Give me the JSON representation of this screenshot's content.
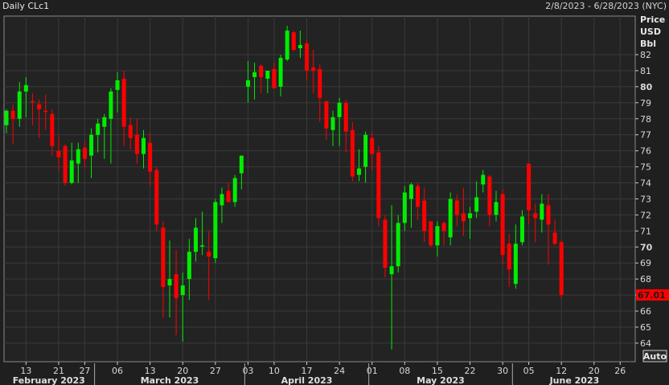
{
  "header": {
    "title": "Daily CLc1",
    "date_range": "2/8/2023 - 6/28/2023 (NYC)"
  },
  "axis_units": [
    "Price",
    "USD",
    "Bbl"
  ],
  "auto_button": "Auto",
  "colors": {
    "up": "#00ee00",
    "down": "#ff0000",
    "background": "#232323",
    "grid": "#3a3a3a",
    "last_price_bg": "#ff0000"
  },
  "chart_data": {
    "type": "candlestick",
    "title": "Daily CLc1",
    "ylabel": "Price USD Bbl",
    "ylim": [
      63.4,
      84.5
    ],
    "yticks": [
      64,
      65,
      66,
      67,
      68,
      69,
      70,
      71,
      72,
      73,
      74,
      75,
      76,
      77,
      78,
      79,
      80,
      81,
      82
    ],
    "bold_yticks": [
      70,
      80
    ],
    "last_price": "67.01",
    "grid": true,
    "columns": [
      "date",
      "open",
      "high",
      "low",
      "close"
    ],
    "candles": [
      [
        "02-08",
        77.6,
        78.6,
        77.1,
        78.5
      ],
      [
        "02-09",
        78.5,
        78.9,
        76.4,
        78.0
      ],
      [
        "02-10",
        78.0,
        80.3,
        77.5,
        79.7
      ],
      [
        "02-13",
        79.7,
        80.6,
        78.1,
        80.1
      ],
      [
        "02-14",
        79.1,
        79.6,
        77.6,
        79.05
      ],
      [
        "02-15",
        78.9,
        79.2,
        76.8,
        78.6
      ],
      [
        "02-16",
        78.5,
        79.5,
        77.3,
        78.45
      ],
      [
        "02-17",
        78.3,
        78.6,
        75.7,
        76.3
      ],
      [
        "02-21",
        76.0,
        76.9,
        74.8,
        75.6
      ],
      [
        "02-22",
        76.3,
        76.4,
        73.8,
        74.0
      ],
      [
        "02-23",
        74.0,
        76.5,
        73.9,
        75.4
      ],
      [
        "02-24",
        75.2,
        76.5,
        74.0,
        76.1
      ],
      [
        "02-27",
        76.2,
        76.6,
        75.0,
        75.5
      ],
      [
        "02-28",
        75.7,
        77.4,
        74.3,
        77.0
      ],
      [
        "03-01",
        77.0,
        78.0,
        75.9,
        77.7
      ],
      [
        "03-02",
        77.5,
        78.3,
        75.5,
        78.1
      ],
      [
        "03-03",
        78.0,
        79.9,
        75.2,
        79.7
      ],
      [
        "03-06",
        79.8,
        80.9,
        78.4,
        80.4
      ],
      [
        "03-07",
        80.5,
        81.0,
        76.3,
        77.5
      ],
      [
        "03-08",
        77.6,
        78.1,
        76.1,
        76.8
      ],
      [
        "03-09",
        77.0,
        78.0,
        75.2,
        75.8
      ],
      [
        "03-10",
        75.8,
        77.3,
        74.9,
        76.8
      ],
      [
        "03-13",
        76.5,
        77.1,
        73.8,
        74.7
      ],
      [
        "03-14",
        74.8,
        75.0,
        71.0,
        71.4
      ],
      [
        "03-15",
        71.2,
        71.6,
        65.6,
        67.5
      ],
      [
        "03-16",
        67.6,
        70.4,
        65.6,
        68.0
      ],
      [
        "03-17",
        68.3,
        69.8,
        64.5,
        66.8
      ],
      [
        "03-20",
        67.0,
        68.4,
        64.1,
        67.6
      ],
      [
        "03-21",
        68.0,
        70.5,
        66.7,
        69.7
      ],
      [
        "03-22",
        69.7,
        71.8,
        69.1,
        71.2
      ],
      [
        "03-23",
        70.05,
        72.2,
        69.5,
        70.1
      ],
      [
        "03-24",
        69.7,
        71.0,
        66.7,
        69.4
      ],
      [
        "03-27",
        69.3,
        73.0,
        69.0,
        72.8
      ],
      [
        "03-28",
        72.6,
        73.7,
        71.5,
        73.3
      ],
      [
        "03-29",
        73.5,
        74.0,
        72.8,
        72.8
      ],
      [
        "03-30",
        72.8,
        74.5,
        72.5,
        74.3
      ],
      [
        "03-31",
        74.6,
        75.7,
        73.6,
        75.7
      ],
      [
        "04-03",
        80.0,
        81.6,
        79.0,
        80.4
      ],
      [
        "04-04",
        80.6,
        81.5,
        79.2,
        80.9
      ],
      [
        "04-05",
        81.3,
        81.4,
        79.6,
        80.6
      ],
      [
        "04-06",
        80.5,
        81.0,
        79.6,
        81.0
      ],
      [
        "04-10",
        81.1,
        81.5,
        79.9,
        79.9
      ],
      [
        "04-11",
        80.0,
        82.0,
        79.4,
        81.8
      ],
      [
        "04-12",
        81.7,
        83.8,
        81.6,
        83.5
      ],
      [
        "04-13",
        83.4,
        83.5,
        82.2,
        82.3
      ],
      [
        "04-14",
        82.4,
        83.5,
        81.8,
        82.6
      ],
      [
        "04-17",
        82.7,
        82.9,
        80.4,
        81.0
      ],
      [
        "04-18",
        81.2,
        82.3,
        79.6,
        81.0
      ],
      [
        "04-19",
        81.1,
        81.4,
        77.8,
        79.3
      ],
      [
        "04-20",
        79.1,
        79.1,
        76.7,
        77.4
      ],
      [
        "04-21",
        77.3,
        78.5,
        76.3,
        78.1
      ],
      [
        "04-24",
        78.1,
        79.3,
        76.3,
        79.0
      ],
      [
        "04-25",
        79.0,
        79.2,
        75.9,
        77.2
      ],
      [
        "04-26",
        77.3,
        77.8,
        74.1,
        74.4
      ],
      [
        "04-27",
        74.5,
        76.1,
        74.1,
        74.9
      ],
      [
        "04-28",
        75.0,
        77.2,
        74.0,
        77.0
      ],
      [
        "05-01",
        76.8,
        77.2,
        74.8,
        75.8
      ],
      [
        "05-02",
        75.9,
        76.3,
        71.3,
        71.8
      ],
      [
        "05-03",
        71.7,
        72.0,
        68.1,
        68.7
      ],
      [
        "05-04",
        68.3,
        72.6,
        63.6,
        68.8
      ],
      [
        "05-05",
        68.8,
        72.0,
        68.4,
        71.5
      ],
      [
        "05-08",
        71.5,
        73.8,
        71.0,
        73.4
      ],
      [
        "05-09",
        73.0,
        74.0,
        71.2,
        73.9
      ],
      [
        "05-10",
        73.8,
        74.0,
        71.7,
        72.5
      ],
      [
        "05-11",
        72.9,
        73.7,
        70.3,
        71.0
      ],
      [
        "05-12",
        71.6,
        71.6,
        70.0,
        70.1
      ],
      [
        "05-15",
        70.1,
        71.6,
        69.4,
        71.3
      ],
      [
        "05-16",
        71.5,
        71.6,
        70.1,
        71.0
      ],
      [
        "05-17",
        70.6,
        73.4,
        70.1,
        73.0
      ],
      [
        "05-18",
        72.9,
        73.3,
        71.3,
        72.0
      ],
      [
        "05-19",
        72.1,
        73.7,
        70.7,
        71.6
      ],
      [
        "05-22",
        71.8,
        72.5,
        70.5,
        72.1
      ],
      [
        "05-23",
        72.2,
        74.1,
        71.8,
        73.1
      ],
      [
        "05-24",
        73.9,
        74.8,
        73.4,
        74.5
      ],
      [
        "05-25",
        74.4,
        74.5,
        71.3,
        72.0
      ],
      [
        "05-26",
        72.0,
        73.5,
        71.6,
        72.8
      ],
      [
        "05-30",
        73.3,
        73.6,
        68.9,
        69.5
      ],
      [
        "05-31",
        70.2,
        70.8,
        67.5,
        68.6
      ],
      [
        "06-01",
        67.7,
        71.4,
        67.4,
        70.2
      ],
      [
        "06-02",
        70.3,
        72.3,
        70.1,
        71.9
      ],
      [
        "06-05",
        75.2,
        75.2,
        71.4,
        72.3
      ],
      [
        "06-06",
        72.1,
        72.7,
        70.3,
        71.8
      ],
      [
        "06-07",
        71.7,
        73.3,
        70.9,
        72.7
      ],
      [
        "06-08",
        72.6,
        73.3,
        68.9,
        71.4
      ],
      [
        "06-09",
        70.9,
        71.7,
        70.1,
        70.2
      ],
      [
        "06-12",
        70.3,
        70.4,
        66.8,
        67.01
      ]
    ],
    "axis_extension_dates": [
      "06-13",
      "06-14",
      "06-15",
      "06-16",
      "06-20",
      "06-21",
      "06-22",
      "06-23",
      "06-26",
      "06-27",
      "06-28"
    ],
    "xticks": [
      {
        "date": "02-13",
        "label": "13"
      },
      {
        "date": "02-21",
        "label": "21"
      },
      {
        "date": "02-27",
        "label": "27"
      },
      {
        "date": "03-06",
        "label": "06"
      },
      {
        "date": "03-13",
        "label": "13"
      },
      {
        "date": "03-20",
        "label": "20"
      },
      {
        "date": "03-27",
        "label": "27"
      },
      {
        "date": "04-03",
        "label": "03"
      },
      {
        "date": "04-10",
        "label": "10"
      },
      {
        "date": "04-17",
        "label": "17"
      },
      {
        "date": "04-24",
        "label": "24"
      },
      {
        "date": "05-01",
        "label": "01"
      },
      {
        "date": "05-08",
        "label": "08"
      },
      {
        "date": "05-15",
        "label": "15"
      },
      {
        "date": "05-22",
        "label": "22"
      },
      {
        "date": "05-30",
        "label": "30"
      },
      {
        "date": "06-05",
        "label": "05"
      },
      {
        "date": "06-12",
        "label": "12"
      },
      {
        "date": "06-20",
        "label": "20"
      },
      {
        "date": "06-26",
        "label": "26"
      }
    ],
    "months": [
      {
        "label": "February 2023",
        "start": "02-08",
        "end": "02-28"
      },
      {
        "label": "March 2023",
        "start": "03-01",
        "end": "03-31"
      },
      {
        "label": "April 2023",
        "start": "04-03",
        "end": "04-28"
      },
      {
        "label": "May 2023",
        "start": "05-01",
        "end": "05-31"
      },
      {
        "label": "June 2023",
        "start": "06-01",
        "end": "06-28"
      }
    ]
  }
}
